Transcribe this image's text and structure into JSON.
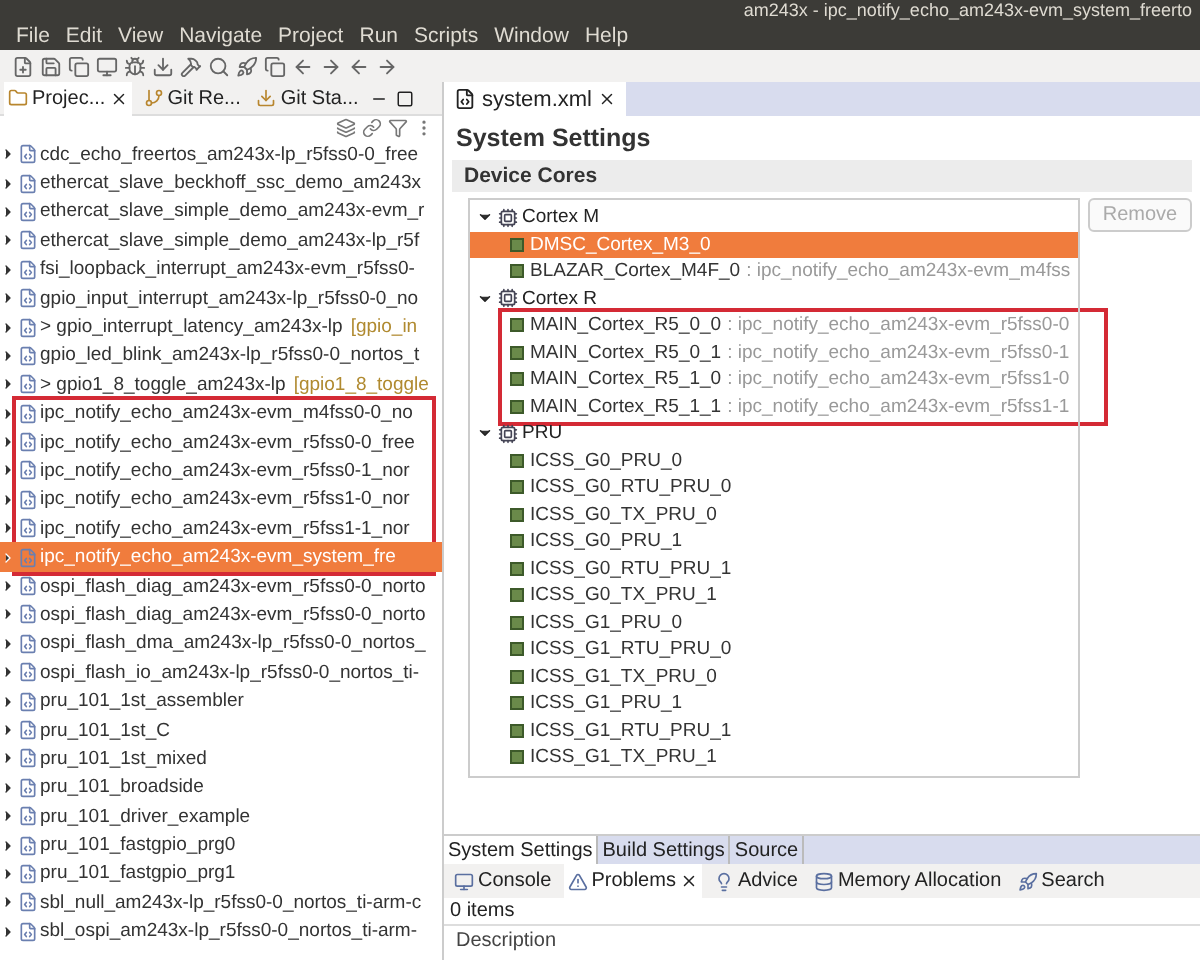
{
  "window": {
    "title": "am243x - ipc_notify_echo_am243x-evm_system_freerto"
  },
  "menu": [
    "File",
    "Edit",
    "View",
    "Navigate",
    "Project",
    "Run",
    "Scripts",
    "Window",
    "Help"
  ],
  "side_tabs": [
    {
      "label": "Projec...",
      "selected": true,
      "kind": "project"
    },
    {
      "label": "Git Re...",
      "selected": false,
      "kind": "git"
    },
    {
      "label": "Git Sta...",
      "selected": false,
      "kind": "stage"
    }
  ],
  "projects": [
    {
      "label": "cdc_echo_freertos_am243x-lp_r5fss0-0_free",
      "selected": false
    },
    {
      "label": "ethercat_slave_beckhoff_ssc_demo_am243x",
      "selected": false
    },
    {
      "label": "ethercat_slave_simple_demo_am243x-evm_r",
      "selected": false
    },
    {
      "label": "ethercat_slave_simple_demo_am243x-lp_r5f",
      "selected": false
    },
    {
      "label": "fsi_loopback_interrupt_am243x-evm_r5fss0-",
      "selected": false
    },
    {
      "label": "gpio_input_interrupt_am243x-lp_r5fss0-0_no",
      "selected": false
    },
    {
      "label": "> gpio_interrupt_latency_am243x-lp",
      "suffix": "[gpio_in",
      "selected": false
    },
    {
      "label": "gpio_led_blink_am243x-lp_r5fss0-0_nortos_t",
      "selected": false
    },
    {
      "label": "> gpio1_8_toggle_am243x-lp",
      "suffix": "[gpio1_8_toggle",
      "selected": false
    },
    {
      "label": "ipc_notify_echo_am243x-evm_m4fss0-0_no",
      "selected": false
    },
    {
      "label": "ipc_notify_echo_am243x-evm_r5fss0-0_free",
      "selected": false
    },
    {
      "label": "ipc_notify_echo_am243x-evm_r5fss0-1_nor",
      "selected": false
    },
    {
      "label": "ipc_notify_echo_am243x-evm_r5fss1-0_nor",
      "selected": false
    },
    {
      "label": "ipc_notify_echo_am243x-evm_r5fss1-1_nor",
      "selected": false
    },
    {
      "label": "ipc_notify_echo_am243x-evm_system_fre",
      "selected": true
    },
    {
      "label": "ospi_flash_diag_am243x-evm_r5fss0-0_norto",
      "selected": false
    },
    {
      "label": "ospi_flash_diag_am243x-evm_r5fss0-0_norto",
      "selected": false
    },
    {
      "label": "ospi_flash_dma_am243x-lp_r5fss0-0_nortos_",
      "selected": false
    },
    {
      "label": "ospi_flash_io_am243x-lp_r5fss0-0_nortos_ti-",
      "selected": false
    },
    {
      "label": "pru_101_1st_assembler",
      "selected": false
    },
    {
      "label": "pru_101_1st_C",
      "selected": false
    },
    {
      "label": "pru_101_1st_mixed",
      "selected": false
    },
    {
      "label": "pru_101_broadside",
      "selected": false
    },
    {
      "label": "pru_101_driver_example",
      "selected": false
    },
    {
      "label": "pru_101_fastgpio_prg0",
      "selected": false
    },
    {
      "label": "pru_101_fastgpio_prg1",
      "selected": false
    },
    {
      "label": "sbl_null_am243x-lp_r5fss0-0_nortos_ti-arm-c",
      "selected": false
    },
    {
      "label": "sbl_ospi_am243x-lp_r5fss0-0_nortos_ti-arm-",
      "selected": false
    }
  ],
  "editor": {
    "tab": "system.xml",
    "heading": "System Settings",
    "section": "Device Cores",
    "remove_button": "Remove",
    "core_groups": [
      {
        "name": "Cortex M",
        "expanded": true,
        "children": [
          {
            "name": "DMSC_Cortex_M3_0",
            "selected": true
          },
          {
            "name": "BLAZAR_Cortex_M4F_0",
            "program": ": ipc_notify_echo_am243x-evm_m4fss",
            "selected": false
          }
        ]
      },
      {
        "name": "Cortex R",
        "expanded": true,
        "children": [
          {
            "name": "MAIN_Cortex_R5_0_0",
            "program": ": ipc_notify_echo_am243x-evm_r5fss0-0",
            "selected": false
          },
          {
            "name": "MAIN_Cortex_R5_0_1",
            "program": ": ipc_notify_echo_am243x-evm_r5fss0-1",
            "selected": false
          },
          {
            "name": "MAIN_Cortex_R5_1_0",
            "program": ": ipc_notify_echo_am243x-evm_r5fss1-0",
            "selected": false
          },
          {
            "name": "MAIN_Cortex_R5_1_1",
            "program": ": ipc_notify_echo_am243x-evm_r5fss1-1",
            "selected": false
          }
        ]
      },
      {
        "name": "PRU",
        "expanded": true,
        "children": [
          {
            "name": "ICSS_G0_PRU_0",
            "selected": false
          },
          {
            "name": "ICSS_G0_RTU_PRU_0",
            "selected": false
          },
          {
            "name": "ICSS_G0_TX_PRU_0",
            "selected": false
          },
          {
            "name": "ICSS_G0_PRU_1",
            "selected": false
          },
          {
            "name": "ICSS_G0_RTU_PRU_1",
            "selected": false
          },
          {
            "name": "ICSS_G0_TX_PRU_1",
            "selected": false
          },
          {
            "name": "ICSS_G1_PRU_0",
            "selected": false
          },
          {
            "name": "ICSS_G1_RTU_PRU_0",
            "selected": false
          },
          {
            "name": "ICSS_G1_TX_PRU_0",
            "selected": false
          },
          {
            "name": "ICSS_G1_PRU_1",
            "selected": false
          },
          {
            "name": "ICSS_G1_RTU_PRU_1",
            "selected": false
          },
          {
            "name": "ICSS_G1_TX_PRU_1",
            "selected": false
          }
        ]
      }
    ],
    "page_tabs": [
      {
        "label": "System Settings",
        "selected": true
      },
      {
        "label": "Build Settings",
        "selected": false
      },
      {
        "label": "Source",
        "selected": false
      }
    ]
  },
  "bottom": {
    "tabs": [
      {
        "label": "Console",
        "kind": "console",
        "selected": false
      },
      {
        "label": "Problems",
        "kind": "problems",
        "selected": true
      },
      {
        "label": "Advice",
        "kind": "advice",
        "selected": false
      },
      {
        "label": "Memory Allocation",
        "kind": "memory",
        "selected": false
      },
      {
        "label": "Search",
        "kind": "search",
        "selected": false
      }
    ],
    "count": "0 items",
    "column": "Description"
  }
}
